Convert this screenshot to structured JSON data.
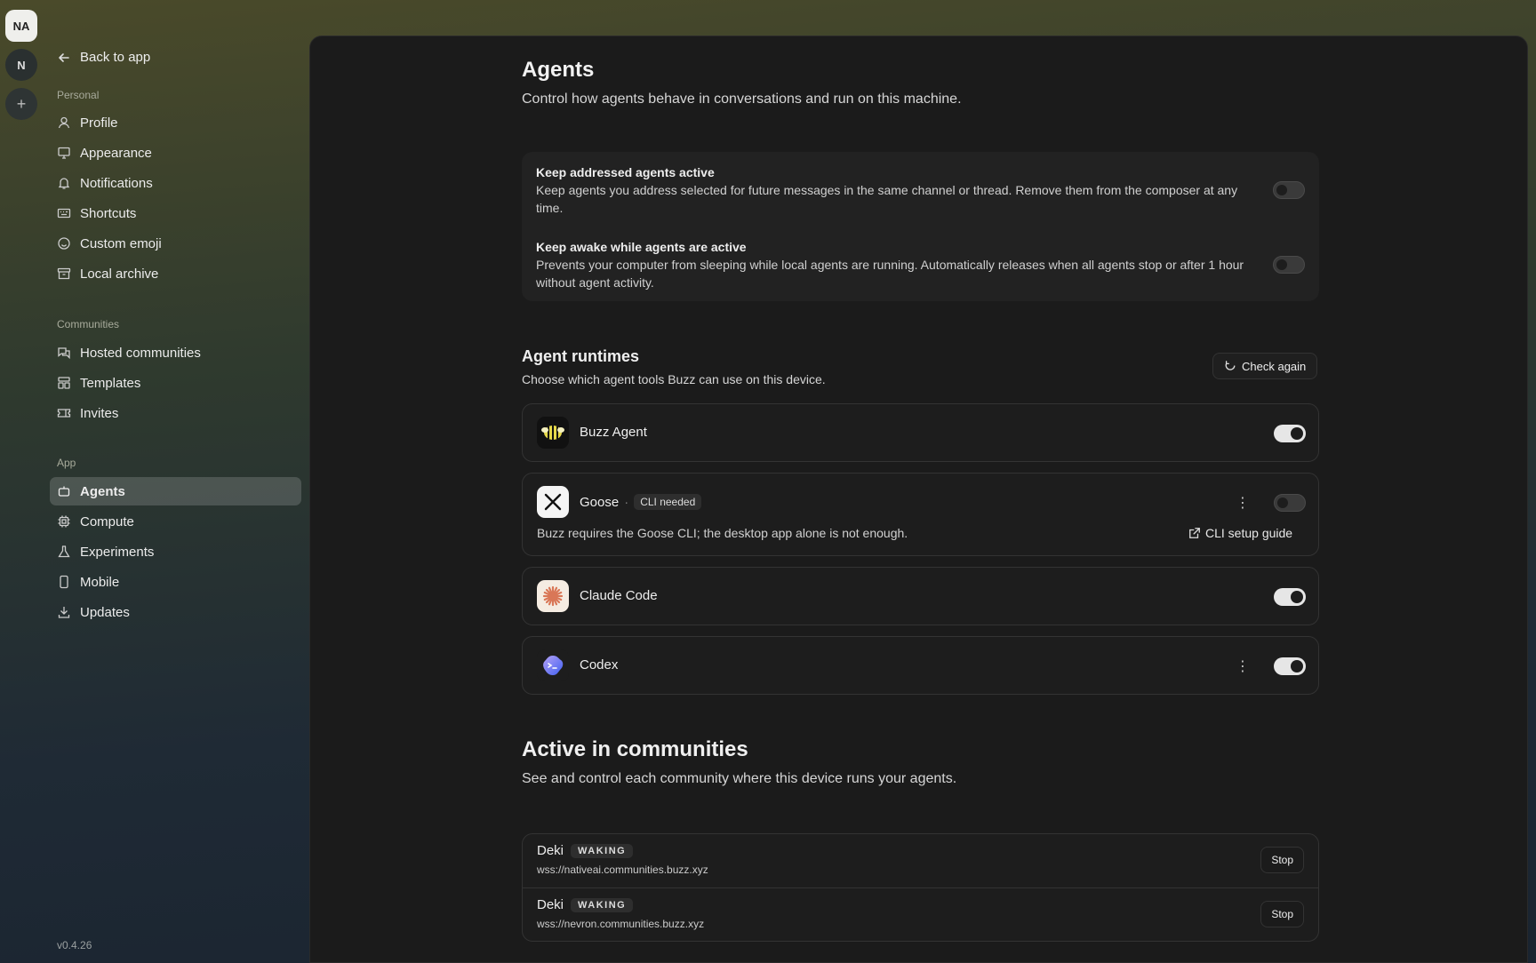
{
  "workspaces": [
    {
      "label": "NA"
    },
    {
      "label": "N"
    },
    {
      "label": "+"
    }
  ],
  "sidebar": {
    "back_label": "Back to app",
    "sections": [
      {
        "label": "Personal",
        "items": [
          {
            "label": "Profile",
            "icon": "user-icon"
          },
          {
            "label": "Appearance",
            "icon": "monitor-icon"
          },
          {
            "label": "Notifications",
            "icon": "bell-icon"
          },
          {
            "label": "Shortcuts",
            "icon": "keyboard-icon"
          },
          {
            "label": "Custom emoji",
            "icon": "smile-icon"
          },
          {
            "label": "Local archive",
            "icon": "archive-icon"
          }
        ]
      },
      {
        "label": "Communities",
        "items": [
          {
            "label": "Hosted communities",
            "icon": "chat-icon"
          },
          {
            "label": "Templates",
            "icon": "template-icon"
          },
          {
            "label": "Invites",
            "icon": "ticket-icon"
          }
        ]
      },
      {
        "label": "App",
        "items": [
          {
            "label": "Agents",
            "icon": "bot-icon",
            "selected": true
          },
          {
            "label": "Compute",
            "icon": "cpu-icon"
          },
          {
            "label": "Experiments",
            "icon": "flask-icon"
          },
          {
            "label": "Mobile",
            "icon": "phone-icon"
          },
          {
            "label": "Updates",
            "icon": "download-icon"
          }
        ]
      }
    ],
    "version": "v0.4.26"
  },
  "page": {
    "title": "Agents",
    "subtitle": "Control how agents behave in conversations and run on this machine."
  },
  "settings": [
    {
      "title": "Keep addressed agents active",
      "desc": "Keep agents you address selected for future messages in the same channel or thread. Remove them from the composer at any time.",
      "enabled": false
    },
    {
      "title": "Keep awake while agents are active",
      "desc": "Prevents your computer from sleeping while local agents are running. Automatically releases when all agents stop or after 1 hour without agent activity.",
      "enabled": false
    }
  ],
  "runtimes": {
    "title": "Agent runtimes",
    "subtitle": "Choose which agent tools Buzz can use on this device.",
    "check_again_label": "Check again",
    "items": [
      {
        "name": "Buzz Agent",
        "enabled": true
      },
      {
        "name": "Goose",
        "badge": "CLI needed",
        "separator": "·",
        "enabled": false,
        "note": "Buzz requires the Goose CLI; the desktop app alone is not enough.",
        "link": "CLI setup guide"
      },
      {
        "name": "Claude Code",
        "enabled": true
      },
      {
        "name": "Codex",
        "enabled": true
      }
    ]
  },
  "communities": {
    "title": "Active in communities",
    "subtitle": "See and control each community where this device runs your agents.",
    "rows": [
      {
        "name": "Deki",
        "status": "WAKING",
        "url": "wss://nativeai.communities.buzz.xyz",
        "action": "Stop"
      },
      {
        "name": "Deki",
        "status": "WAKING",
        "url": "wss://nevron.communities.buzz.xyz",
        "action": "Stop"
      }
    ]
  },
  "colors": {
    "panel_bg": "#1b1b1b",
    "card_bg": "#222222",
    "toggle_on": "#e6e6e6"
  }
}
